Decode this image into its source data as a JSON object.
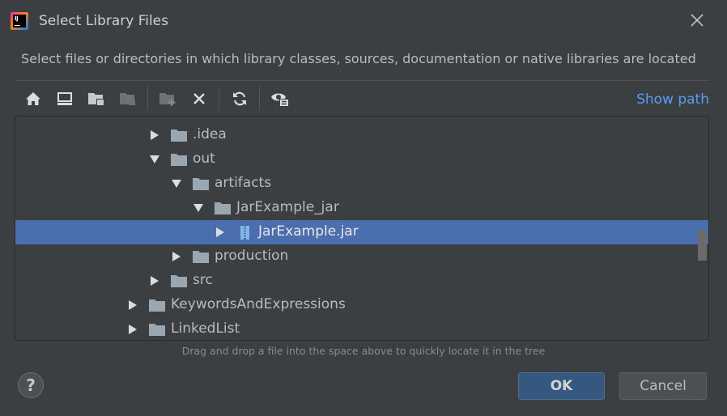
{
  "window": {
    "title": "Select Library Files",
    "logo_text": "IJ",
    "close_icon": "close-icon"
  },
  "description": "Select files or directories in which library classes, sources, documentation or native libraries are located",
  "toolbar": {
    "buttons": [
      "home-icon",
      "desktop-icon",
      "project-folder-icon",
      "module-folder-icon",
      "new-folder-icon",
      "delete-icon",
      "refresh-icon",
      "show-hidden-icon"
    ],
    "show_path_label": "Show path"
  },
  "tree": {
    "items": [
      {
        "label": ".idea",
        "expanded": false,
        "type": "folder",
        "depth": 2
      },
      {
        "label": "out",
        "expanded": true,
        "type": "folder",
        "depth": 2
      },
      {
        "label": "artifacts",
        "expanded": true,
        "type": "folder",
        "depth": 3
      },
      {
        "label": "JarExample_jar",
        "expanded": true,
        "type": "folder",
        "depth": 4
      },
      {
        "label": "JarExample.jar",
        "expanded": false,
        "type": "jar",
        "depth": 5,
        "selected": true
      },
      {
        "label": "production",
        "expanded": false,
        "type": "folder",
        "depth": 3
      },
      {
        "label": "src",
        "expanded": false,
        "type": "folder",
        "depth": 2
      },
      {
        "label": "KeywordsAndExpressions",
        "expanded": false,
        "type": "folder",
        "depth": 1
      },
      {
        "label": "LinkedList",
        "expanded": false,
        "type": "folder",
        "depth": 1
      }
    ]
  },
  "hint": "Drag and drop a file into the space above to quickly locate it in the tree",
  "buttons": {
    "help_label": "?",
    "ok_label": "OK",
    "cancel_label": "Cancel"
  },
  "colors": {
    "background": "#3c3f41",
    "selection": "#4b6eaf",
    "link": "#589df6",
    "ok_button": "#365880",
    "folder": "#9aa7b0"
  }
}
